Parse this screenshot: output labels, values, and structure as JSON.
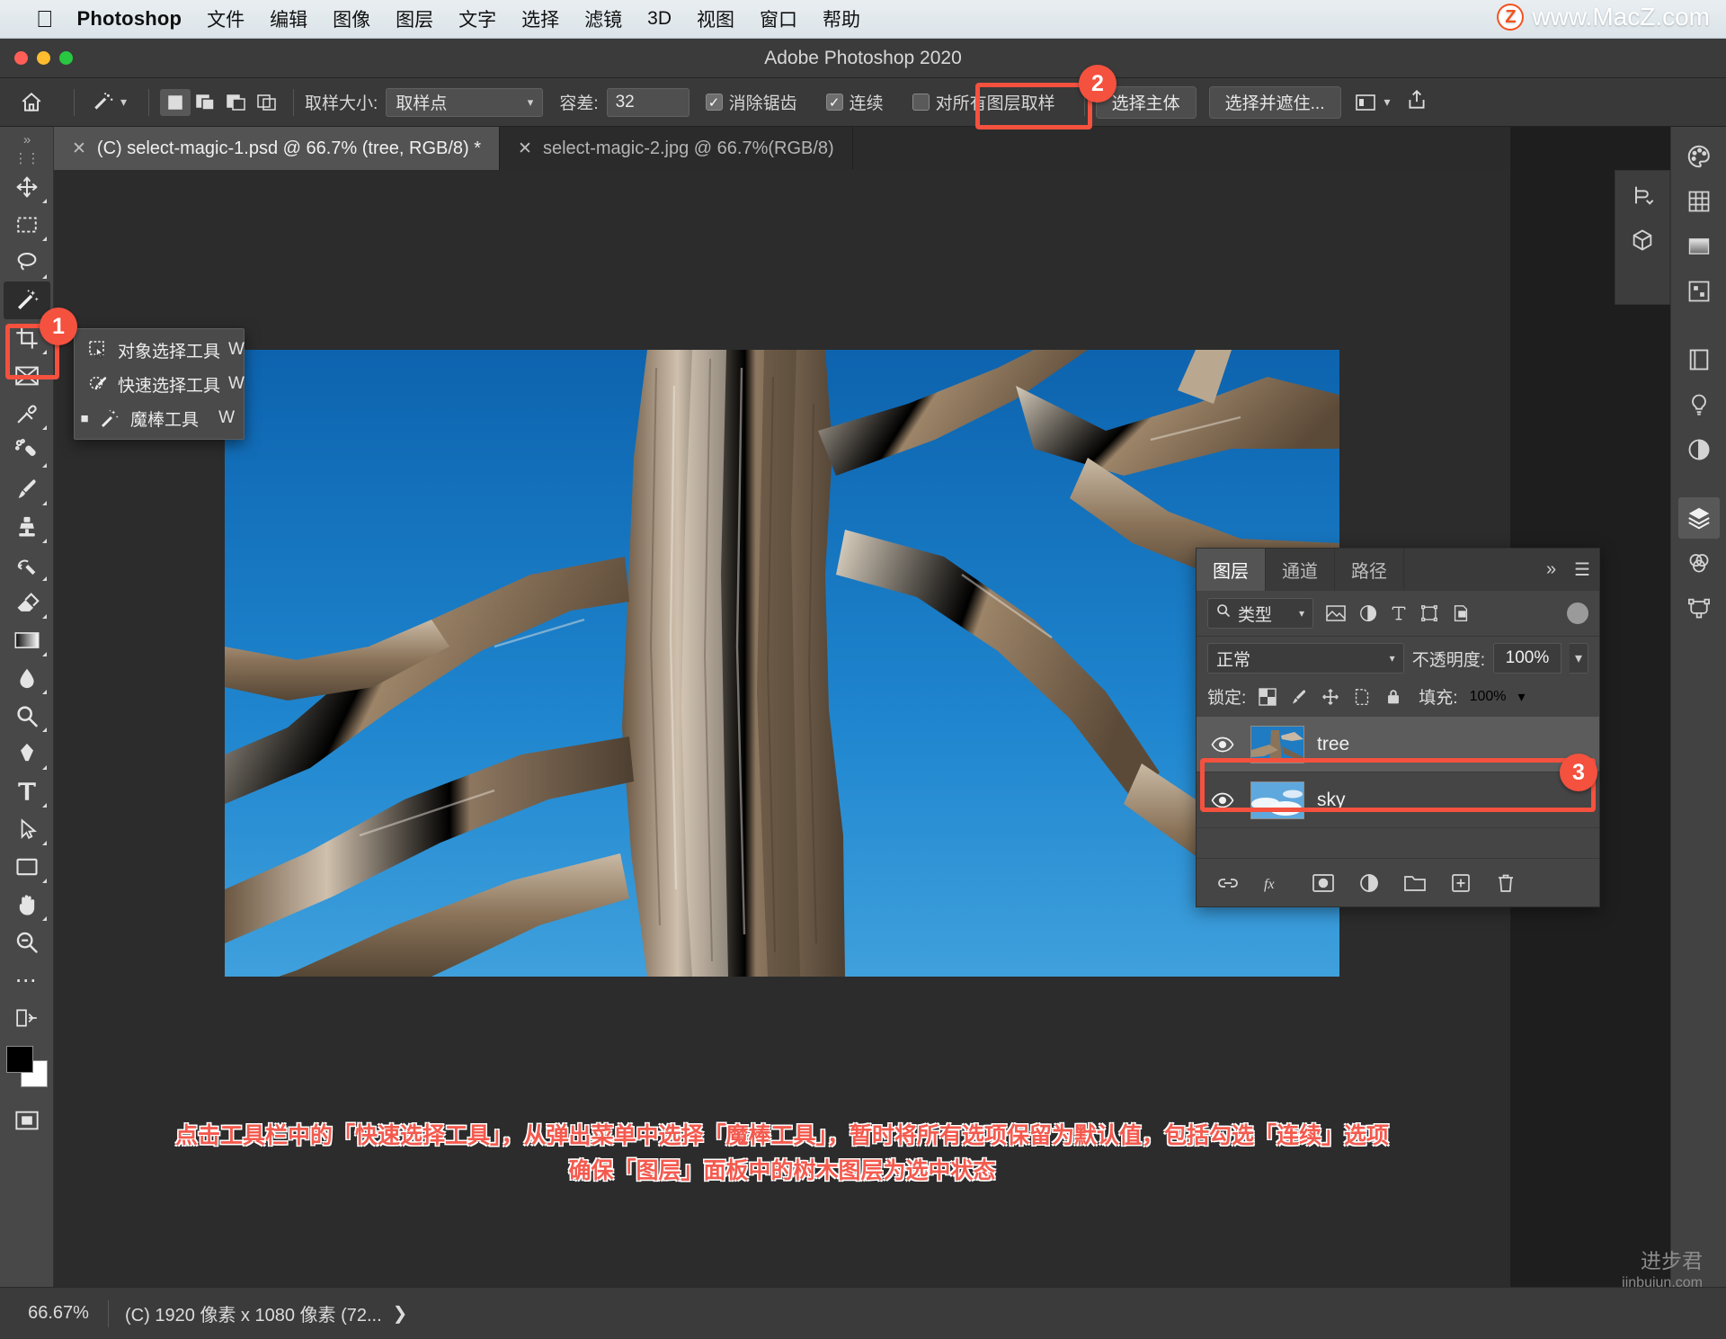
{
  "macmenu": {
    "apple_icon": "apple-logo-icon",
    "app_name": "Photoshop",
    "items": [
      "文件",
      "编辑",
      "图像",
      "图层",
      "文字",
      "选择",
      "滤镜",
      "3D",
      "视图",
      "窗口",
      "帮助"
    ],
    "watermark": {
      "badge": "Z",
      "text": "www.MacZ.com"
    }
  },
  "window": {
    "title": "Adobe Photoshop 2020"
  },
  "options_bar": {
    "home_icon": "home-icon",
    "tool_preset_icon": "magic-wand-icon",
    "selection_modes": [
      "new-selection",
      "add-to-selection",
      "subtract-from-selection",
      "intersect-selection"
    ],
    "sample_size_label": "取样大小:",
    "sample_size_value": "取样点",
    "tolerance_label": "容差:",
    "tolerance_value": "32",
    "antialias_label": "消除锯齿",
    "antialias_checked": true,
    "contiguous_label": "连续",
    "contiguous_checked": true,
    "sample_all_layers_label": "对所有图层取样",
    "sample_all_layers_checked": false,
    "select_subject_label": "选择主体",
    "select_and_mask_label": "选择并遮住...",
    "workspace_icon": "workspace-switcher-icon",
    "share_icon": "share-icon"
  },
  "tabs": [
    {
      "label": "(C) select-magic-1.psd @ 66.7% (tree, RGB/8) *",
      "active": true,
      "close_icon": "close-icon"
    },
    {
      "label": "select-magic-2.jpg @ 66.7%(RGB/8)",
      "active": false,
      "close_icon": "close-icon"
    }
  ],
  "toolbar": {
    "tools": [
      {
        "name": "move-tool",
        "icon": "move-icon"
      },
      {
        "name": "marquee-tool",
        "icon": "rectangular-marquee-icon"
      },
      {
        "name": "lasso-tool",
        "icon": "lasso-icon"
      },
      {
        "name": "magic-wand-tool",
        "icon": "magic-wand-icon",
        "selected": true
      },
      {
        "name": "crop-tool",
        "icon": "crop-icon"
      },
      {
        "name": "frame-tool",
        "icon": "frame-icon"
      },
      {
        "name": "eyedropper-tool",
        "icon": "eyedropper-icon"
      },
      {
        "name": "healing-brush-tool",
        "icon": "healing-brush-icon"
      },
      {
        "name": "brush-tool",
        "icon": "brush-icon"
      },
      {
        "name": "clone-stamp-tool",
        "icon": "clone-stamp-icon"
      },
      {
        "name": "history-brush-tool",
        "icon": "history-brush-icon"
      },
      {
        "name": "eraser-tool",
        "icon": "eraser-icon"
      },
      {
        "name": "gradient-tool",
        "icon": "gradient-icon"
      },
      {
        "name": "blur-tool",
        "icon": "blur-drop-icon"
      },
      {
        "name": "dodge-tool",
        "icon": "dodge-icon"
      },
      {
        "name": "pen-tool",
        "icon": "pen-icon"
      },
      {
        "name": "type-tool",
        "icon": "type-t-icon"
      },
      {
        "name": "path-selection-tool",
        "icon": "path-arrow-icon"
      },
      {
        "name": "rectangle-tool",
        "icon": "rectangle-icon"
      },
      {
        "name": "hand-tool",
        "icon": "hand-icon"
      },
      {
        "name": "zoom-tool",
        "icon": "zoom-magnifier-icon"
      },
      {
        "name": "more-tools",
        "icon": "ellipsis-icon"
      },
      {
        "name": "edit-toolbar",
        "icon": "edit-toolbar-icon"
      }
    ],
    "foreground_color": "#000000",
    "background_color": "#ffffff",
    "quickmask_icon": "quick-mask-icon"
  },
  "tool_flyout": {
    "items": [
      {
        "label": "对象选择工具",
        "shortcut": "W",
        "icon": "object-selection-icon",
        "current": false
      },
      {
        "label": "快速选择工具",
        "shortcut": "W",
        "icon": "quick-selection-icon",
        "current": false
      },
      {
        "label": "魔棒工具",
        "shortcut": "W",
        "icon": "magic-wand-icon",
        "current": true
      }
    ]
  },
  "layers_panel": {
    "tabs": [
      {
        "label": "图层",
        "active": true
      },
      {
        "label": "通道",
        "active": false
      },
      {
        "label": "路径",
        "active": false
      }
    ],
    "expand_icon": "chevron-double-right-icon",
    "menu_icon": "panel-menu-icon",
    "filter_label": "类型",
    "filter_search_icon": "search-icon",
    "filter_icons": [
      "pixel-layer-filter-icon",
      "adjustment-layer-filter-icon",
      "type-layer-filter-icon",
      "shape-layer-filter-icon",
      "smart-object-filter-icon"
    ],
    "blend_mode": "正常",
    "opacity_label": "不透明度:",
    "opacity_value": "100%",
    "lock_label": "锁定:",
    "lock_icons": [
      "lock-transparent-pixels-icon",
      "lock-image-pixels-icon",
      "lock-position-icon",
      "lock-artboard-nesting-icon",
      "lock-all-icon"
    ],
    "fill_label": "填充:",
    "fill_value": "100%",
    "layers": [
      {
        "name": "tree",
        "visible": true,
        "selected": true,
        "eye_icon": "eye-icon"
      },
      {
        "name": "sky",
        "visible": true,
        "selected": false,
        "eye_icon": "eye-icon"
      }
    ],
    "footer_icons": [
      "link-layers-icon",
      "layer-style-fx-icon",
      "layer-mask-icon",
      "adjustment-layer-icon",
      "new-group-icon",
      "new-layer-icon",
      "delete-layer-icon"
    ]
  },
  "right_rail": {
    "icons": [
      "color-palette-icon",
      "swatches-grid-icon",
      "gradients-icon",
      "patterns-icon",
      "libraries-icon",
      "adjustments-bulb-icon",
      "styles-circle-icon",
      "layers-stack-icon",
      "channels-icon",
      "paths-icon"
    ],
    "mini_panels": [
      "history-panel-icon",
      "3d-object-panel-icon"
    ]
  },
  "caption": {
    "line1": "点击工具栏中的「快速选择工具」，从弹出菜单中选择「魔棒工具」，暂时将所有选项保留为默认值，包括勾选「连续」选项",
    "line2": "确保「图层」面板中的树木图层为选中状态"
  },
  "status_bar": {
    "zoom": "66.67%",
    "doc_info": "(C) 1920 像素 x 1080 像素 (72...",
    "expand_icon": "chevron-right-icon"
  },
  "watermark_bottom": {
    "line1": "进步君",
    "line2": "jinbujun.com"
  },
  "annotations": [
    {
      "id": "1",
      "target": "magic-wand-tool"
    },
    {
      "id": "2",
      "target": "contiguous-checkbox"
    },
    {
      "id": "3",
      "target": "tree-layer-row"
    }
  ],
  "colors": {
    "accent_red": "#f4513f",
    "panel_bg": "#454545",
    "canvas_bg": "#2c2c2c",
    "sky_blue": "#1a6fb5"
  }
}
